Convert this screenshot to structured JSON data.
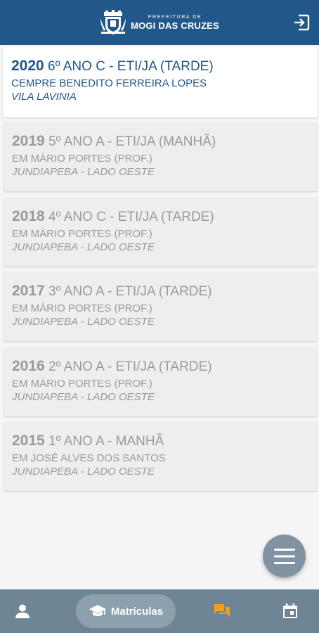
{
  "header": {
    "logo_small": "PREFEITURA DE",
    "logo_big": "MOGI DAS CRUZES",
    "background": "#22578a",
    "logout_icon": "logout-icon"
  },
  "enrollments": [
    {
      "year": "2020",
      "grade": "6º ANO C - ETI/JA (TARDE)",
      "school": "CEMPRE BENEDITO FERREIRA LOPES",
      "district": "VILA LAVINIA",
      "active": true
    },
    {
      "year": "2019",
      "grade": "5º ANO A - ETI/JA (MANHÃ)",
      "school": "EM MÁRIO PORTES (PROF.)",
      "district": "JUNDIAPEBA - LADO OESTE",
      "active": false
    },
    {
      "year": "2018",
      "grade": "4º ANO C - ETI/JA (TARDE)",
      "school": "EM MÁRIO PORTES (PROF.)",
      "district": "JUNDIAPEBA - LADO OESTE",
      "active": false
    },
    {
      "year": "2017",
      "grade": "3º ANO A - ETI/JA (TARDE)",
      "school": "EM MÁRIO PORTES (PROF.)",
      "district": "JUNDIAPEBA - LADO OESTE",
      "active": false
    },
    {
      "year": "2016",
      "grade": "2º ANO A - ETI/JA (TARDE)",
      "school": "EM MÁRIO PORTES (PROF.)",
      "district": "JUNDIAPEBA - LADO OESTE",
      "active": false
    },
    {
      "year": "2015",
      "grade": "1º ANO A - MANHÃ",
      "school": "EM JOSÉ ALVES DOS SANTOS",
      "district": "JUNDIAPEBA - LADO OESTE",
      "active": false
    }
  ],
  "fab": {
    "icon": "menu-icon"
  },
  "bottom_nav": {
    "items": [
      {
        "icon": "person-icon"
      },
      {
        "icon": "graduation-cap-icon",
        "label": "Matrículas",
        "selected": true
      },
      {
        "icon": "chat-icon",
        "accent": "#f0a020"
      },
      {
        "icon": "calendar-icon"
      }
    ]
  }
}
